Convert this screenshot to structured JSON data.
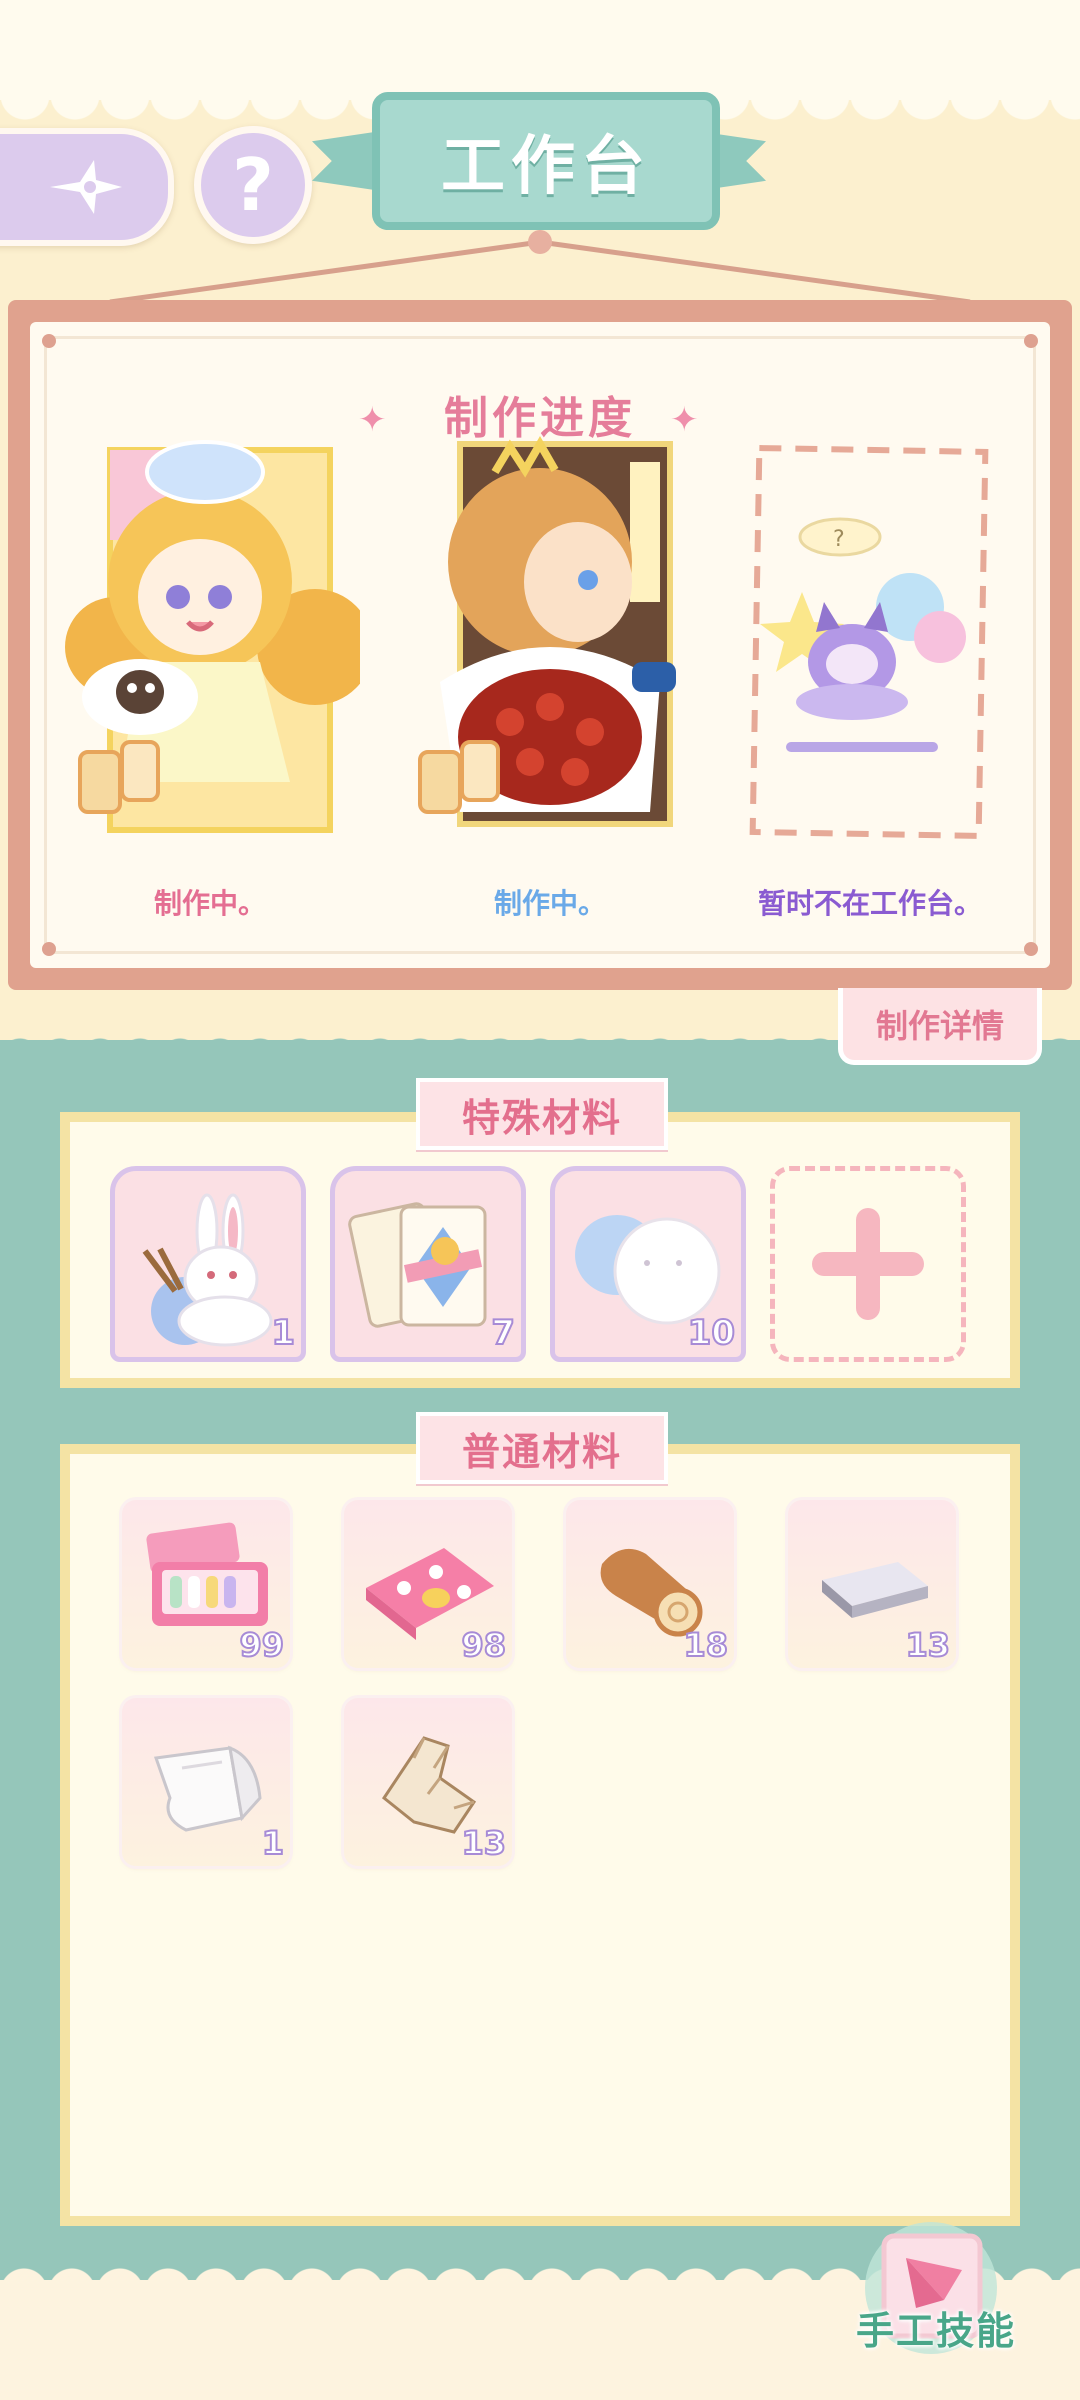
{
  "header": {
    "title": "工作台",
    "back_icon": "compass-star-icon",
    "help_label": "?"
  },
  "progress": {
    "title": "制作进度",
    "slots": [
      {
        "status": "制作中。",
        "status_color": "#e46e92",
        "character": "blonde-girl-with-cat"
      },
      {
        "status": "制作中。",
        "status_color": "#6aa9e8",
        "character": "crowned-boy-with-roses"
      },
      {
        "status": "暂时不在工作台。",
        "status_color": "#8a5bd1",
        "character": "purple-cat-girl-sleeping"
      }
    ],
    "details_button": "制作详情"
  },
  "special_materials": {
    "title": "特殊材料",
    "items": [
      {
        "name": "bunny-yarn",
        "count": "1"
      },
      {
        "name": "playing-cards",
        "count": "7"
      },
      {
        "name": "cotton-cloud",
        "count": "10"
      }
    ],
    "add_icon": "plus-icon"
  },
  "normal_materials": {
    "title": "普通材料",
    "items": [
      {
        "name": "sewing-box",
        "count": "99"
      },
      {
        "name": "pink-fabric",
        "count": "98"
      },
      {
        "name": "wood-log",
        "count": "18"
      },
      {
        "name": "silver-ingot",
        "count": "13"
      },
      {
        "name": "white-cloth",
        "count": "1"
      },
      {
        "name": "fur-pelt",
        "count": "13"
      }
    ]
  },
  "footer": {
    "skill_button": "手工技能"
  },
  "colors": {
    "teal": "#95c6ba",
    "pink_title": "#e57d9a",
    "count_stroke": "#a78bd6"
  }
}
